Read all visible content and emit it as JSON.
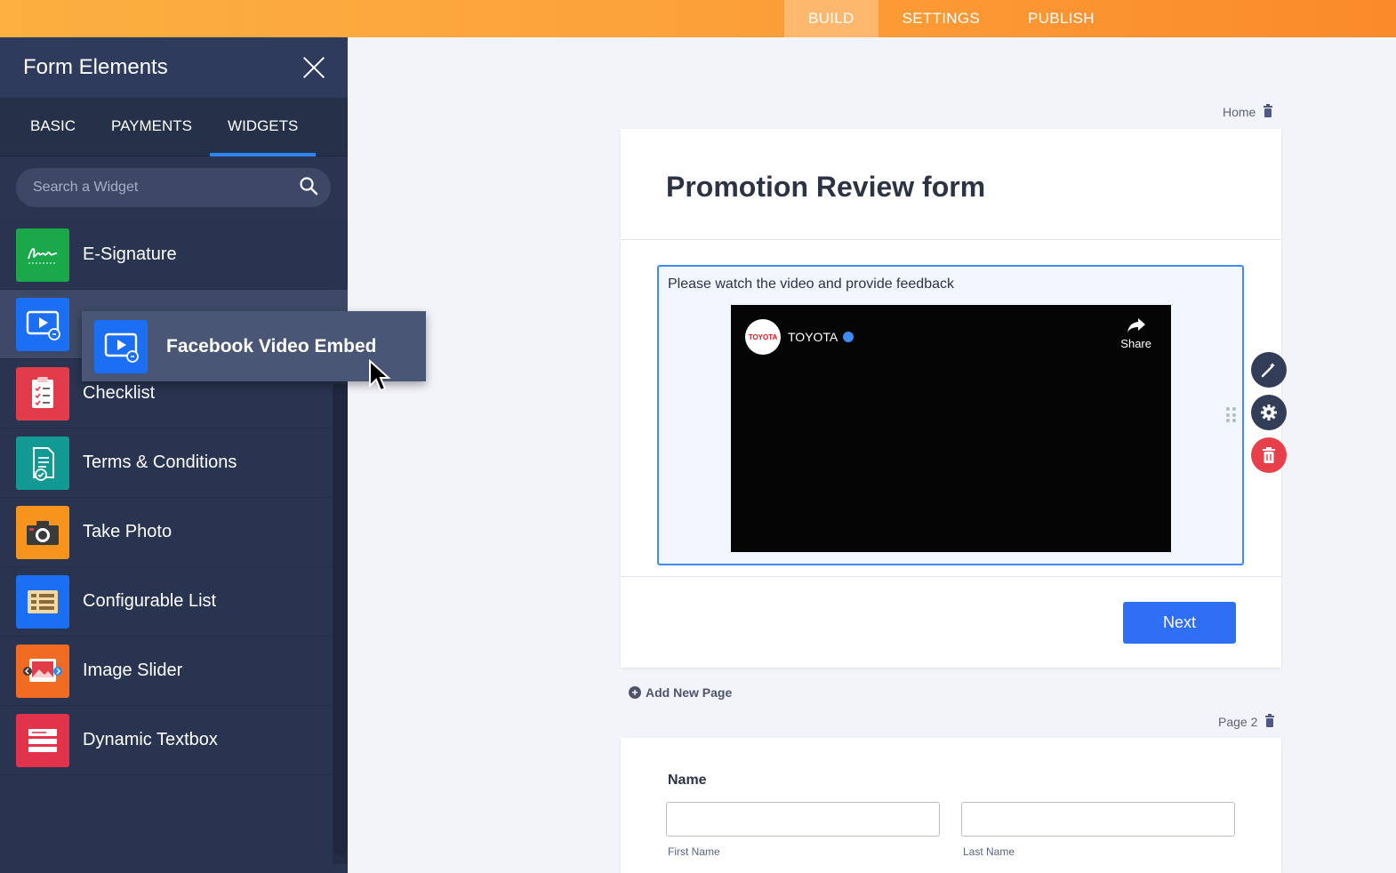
{
  "topbar": {
    "tabs": [
      {
        "label": "BUILD",
        "active": true
      },
      {
        "label": "SETTINGS",
        "active": false
      },
      {
        "label": "PUBLISH",
        "active": false
      }
    ]
  },
  "sidebar": {
    "title": "Form Elements",
    "tabs": [
      {
        "label": "BASIC"
      },
      {
        "label": "PAYMENTS"
      },
      {
        "label": "WIDGETS",
        "active": true
      }
    ],
    "search_placeholder": "Search a Widget",
    "items": [
      {
        "label": "E-Signature",
        "icon": "signature-icon",
        "color": "#1aa84a"
      },
      {
        "label": "",
        "icon": "video-embed-icon",
        "color": "#1a6ff5"
      },
      {
        "label": "Checklist",
        "icon": "checklist-icon",
        "color": "#e23b4a"
      },
      {
        "label": "Terms & Conditions",
        "icon": "document-check-icon",
        "color": "#119a94"
      },
      {
        "label": "Take Photo",
        "icon": "camera-icon",
        "color": "#f7941d"
      },
      {
        "label": "Configurable List",
        "icon": "list-grid-icon",
        "color": "#1a6ff5"
      },
      {
        "label": "Image Slider",
        "icon": "image-slider-icon",
        "color": "#f26b23"
      },
      {
        "label": "Dynamic Textbox",
        "icon": "textbox-icon",
        "color": "#e2334a"
      }
    ]
  },
  "drag_ghost": {
    "label": "Facebook Video Embed",
    "icon": "video-embed-icon"
  },
  "canvas": {
    "page1_label": "Home",
    "form_title": "Promotion Review form",
    "widget_label": "Please watch the video and provide feedback",
    "video": {
      "channel_logo": "TOYOTA",
      "channel_name": "TOYOTA",
      "share_label": "Share"
    },
    "next_label": "Next",
    "add_page_label": "Add New Page",
    "page2_label": "Page 2",
    "name_label": "Name",
    "first_name_label": "First Name",
    "last_name_label": "Last Name"
  },
  "colors": {
    "accent": "#2e6ff4",
    "topbar": "#fb9a35",
    "sidebar": "#293450",
    "danger": "#e8404a"
  }
}
